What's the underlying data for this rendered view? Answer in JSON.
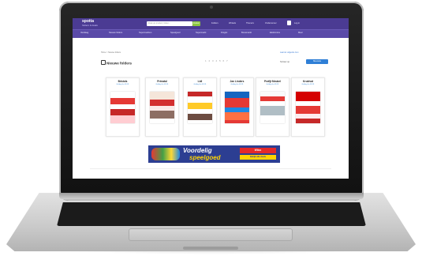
{
  "header": {
    "logo": "spotta",
    "logo_sub": "folders & deals",
    "search_placeholder": "Zoek op product, folder...",
    "search_button": "Zoeken",
    "links": [
      "Folders",
      "Winkels",
      "Thema's",
      "Ondernemer"
    ],
    "login": "Log in",
    "bag_icon": "bag-icon"
  },
  "nav": [
    "Vandaag",
    "Nieuwe folders",
    "Supermarkten",
    "Speelgoed",
    "Supermarkt",
    "Drogist",
    "Bouwmarkt",
    "Elektronica",
    "Meer"
  ],
  "breadcrumb": "Home > Nieuwe folders",
  "page": {
    "title": "Nieuwe folders",
    "pagination": "1 2 3 4 5 6 7",
    "right_link": "Laat de volgende zien",
    "sort_label": "Sorteer op",
    "sort_value": "Nieuwste"
  },
  "cards": [
    {
      "name": "Bristols",
      "date": "Geldig t/m 01/01"
    },
    {
      "name": "Prénatal",
      "date": "Geldig t/m 01/01"
    },
    {
      "name": "Lidl",
      "date": "Geldig t/m 01/01"
    },
    {
      "name": "Jan Linders",
      "date": "Geldig t/m 01/01"
    },
    {
      "name": "Profijt Meubel",
      "date": "Geldig t/m 01/01"
    },
    {
      "name": "Kruidvat",
      "date": "Geldig t/m 01/01"
    }
  ],
  "banner": {
    "line1": "Voordelig",
    "line2": "speelgoed",
    "tag": "Wilco",
    "tag2": "Bekijk alle deals"
  },
  "colors": {
    "brand": "#4b3b93",
    "accent": "#8cc63f",
    "link": "#3a8ad8"
  }
}
